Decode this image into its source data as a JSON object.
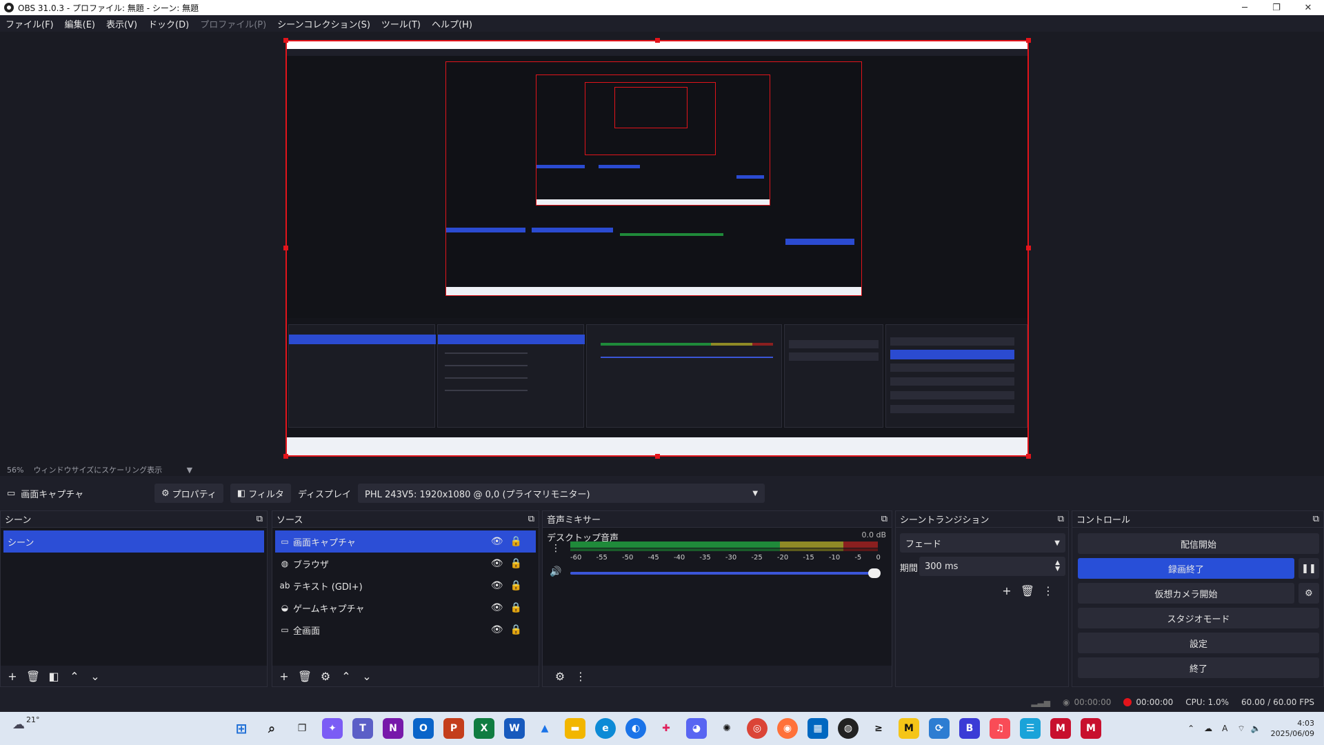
{
  "window": {
    "title": "OBS 31.0.3 - プロファイル: 無題 - シーン: 無題",
    "minimize_glyph": "─",
    "maximize_glyph": "❐",
    "close_glyph": "✕"
  },
  "menu": {
    "items": [
      {
        "label": "ファイル(F)",
        "enabled": true
      },
      {
        "label": "編集(E)",
        "enabled": true
      },
      {
        "label": "表示(V)",
        "enabled": true
      },
      {
        "label": "ドック(D)",
        "enabled": true
      },
      {
        "label": "プロファイル(P)",
        "enabled": false
      },
      {
        "label": "シーンコレクション(S)",
        "enabled": true
      },
      {
        "label": "ツール(T)",
        "enabled": true
      },
      {
        "label": "ヘルプ(H)",
        "enabled": true
      }
    ]
  },
  "preview": {
    "scale_percent": "56%",
    "scale_mode": "ウィンドウサイズにスケーリング表示"
  },
  "source_toolbar": {
    "source_name": "画面キャプチャ",
    "properties_label": "プロパティ",
    "filters_label": "フィルタ",
    "display_label": "ディスプレイ",
    "display_value": "PHL 243V5: 1920x1080 @ 0,0 (プライマリモニター)"
  },
  "scenes": {
    "title": "シーン",
    "items": [
      {
        "label": "シーン",
        "selected": true
      }
    ]
  },
  "sources": {
    "title": "ソース",
    "items": [
      {
        "label": "画面キャプチャ",
        "icon": "monitor-icon",
        "glyph": "▭",
        "selected": true
      },
      {
        "label": "ブラウザ",
        "icon": "globe-icon",
        "glyph": "◍",
        "selected": false
      },
      {
        "label": "テキスト (GDI+)",
        "icon": "text-icon",
        "glyph": "ab",
        "selected": false
      },
      {
        "label": "ゲームキャプチャ",
        "icon": "gamepad-icon",
        "glyph": "◒",
        "selected": false
      },
      {
        "label": "全画面",
        "icon": "monitor-icon",
        "glyph": "▭",
        "selected": false
      }
    ]
  },
  "mixer": {
    "title": "音声ミキサー",
    "channel": "デスクトップ音声",
    "level": "0.0 dB",
    "ticks": [
      "-60",
      "-55",
      "-50",
      "-45",
      "-40",
      "-35",
      "-30",
      "-25",
      "-20",
      "-15",
      "-10",
      "-5",
      "0"
    ],
    "volume_fraction": 0.98
  },
  "transitions": {
    "title": "シーントランジション",
    "type": "フェード",
    "duration_label": "期間",
    "duration_value": "300 ms"
  },
  "controls": {
    "title": "コントロール",
    "start_stream": "配信開始",
    "stop_recording": "録画終了",
    "start_virtual_cam": "仮想カメラ開始",
    "studio_mode": "スタジオモード",
    "settings": "設定",
    "exit": "終了"
  },
  "status": {
    "stream_time": "00:00:00",
    "record_time": "00:00:00",
    "cpu": "CPU: 1.0%",
    "fps": "60.00 / 60.00 FPS"
  },
  "taskbar": {
    "weather": "21°",
    "time": "4:03",
    "date": "2025/06/09",
    "ime": "A"
  },
  "colors": {
    "accent": "#2c4ed6",
    "record_red": "#e3141b",
    "meter_green": "#1f8a3a",
    "meter_yellow": "#8f8a26",
    "meter_red": "#8a1f1f"
  }
}
